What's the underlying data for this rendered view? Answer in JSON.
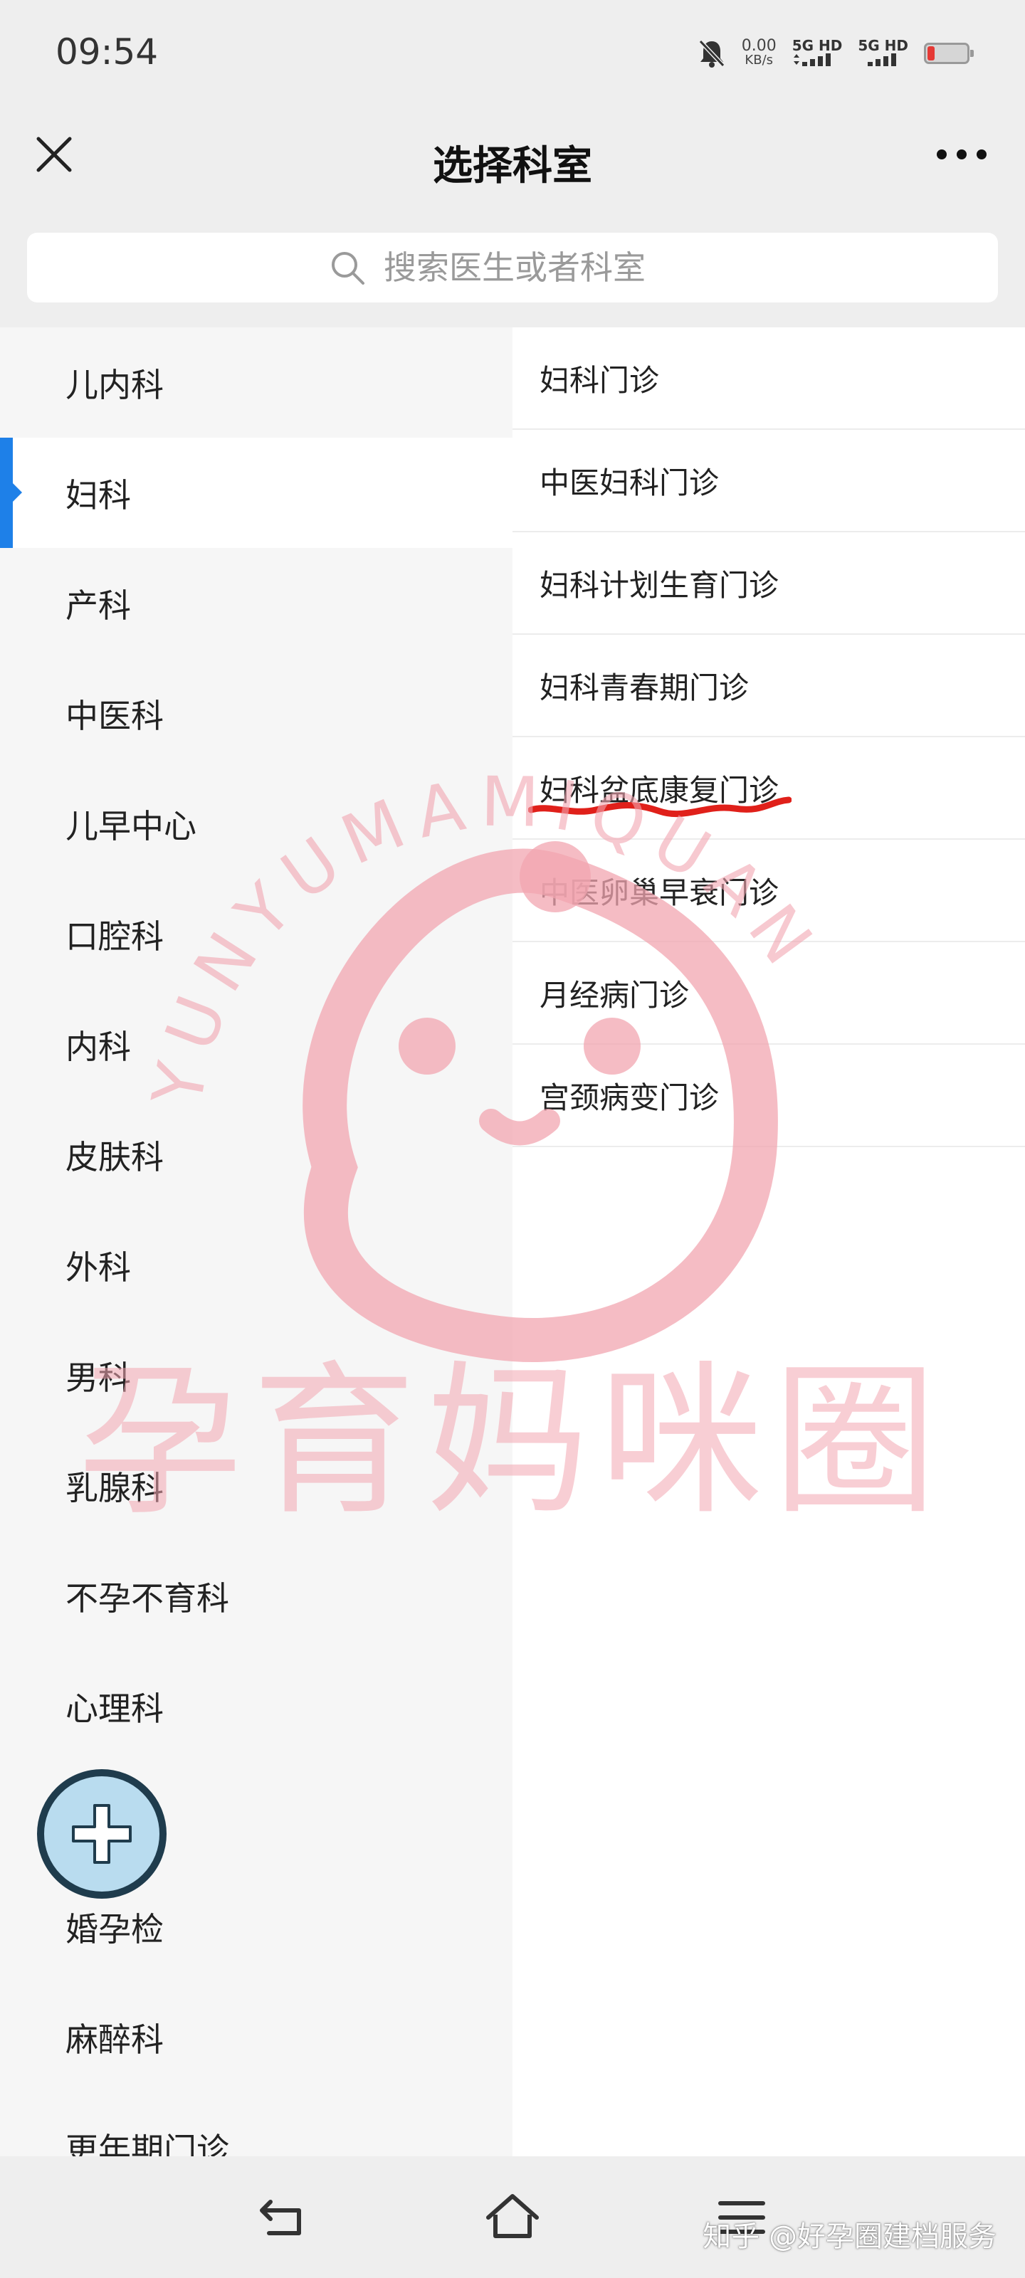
{
  "status_bar": {
    "time": "09:54",
    "net_speed_value": "0.00",
    "net_speed_unit": "KB/s",
    "sim1": "5G HD",
    "sim2": "5G HD"
  },
  "header": {
    "title": "选择科室"
  },
  "search": {
    "placeholder": "搜索医生或者科室"
  },
  "departments": [
    {
      "label": "儿内科"
    },
    {
      "label": "妇科",
      "active": true
    },
    {
      "label": "产科"
    },
    {
      "label": "中医科"
    },
    {
      "label": "儿早中心"
    },
    {
      "label": "口腔科"
    },
    {
      "label": "内科"
    },
    {
      "label": "皮肤科"
    },
    {
      "label": "外科"
    },
    {
      "label": "男科"
    },
    {
      "label": "乳腺科"
    },
    {
      "label": "不孕不育科"
    },
    {
      "label": "心理科"
    },
    {
      "label": ""
    },
    {
      "label": "婚孕检"
    },
    {
      "label": "麻醉科"
    },
    {
      "label": "更年期门诊"
    }
  ],
  "clinics": [
    {
      "label": "妇科门诊"
    },
    {
      "label": "中医妇科门诊"
    },
    {
      "label": "妇科计划生育门诊"
    },
    {
      "label": "妇科青春期门诊"
    },
    {
      "label": "妇科盆底康复门诊"
    },
    {
      "label": "中医卵巢早衰门诊"
    },
    {
      "label": "月经病门诊"
    },
    {
      "label": "宫颈病变门诊"
    }
  ],
  "watermark": {
    "ring_text": "YUNYUMAMIQUAN",
    "brand_text": "孕育妈咪圈",
    "color": "#f2a5b0"
  },
  "footer": {
    "credit": "知乎 @好孕圈建档服务"
  },
  "colors": {
    "accent": "#1e80e8",
    "highlight_underline": "#e0201a"
  },
  "icons": {
    "close": "close-icon",
    "more": "more-icon",
    "search": "search-icon",
    "add": "plus-icon",
    "back": "back-icon",
    "home": "home-icon",
    "menu": "menu-icon",
    "mute": "bell-off-icon",
    "battery": "battery-icon"
  }
}
